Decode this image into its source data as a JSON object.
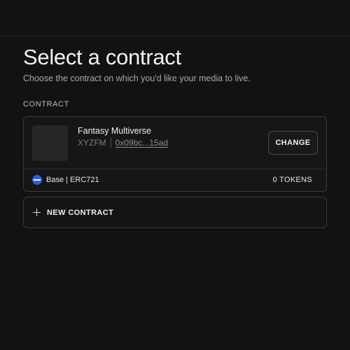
{
  "header": {
    "title": "Select a contract",
    "subtitle": "Choose the contract on which you'd like your media to live."
  },
  "section": {
    "label": "CONTRACT"
  },
  "contract": {
    "name": "Fantasy Multiverse",
    "symbol": "XYZFM",
    "address": "0x09bc...15ad",
    "change_label": "CHANGE",
    "network": "Base | ERC721",
    "tokens": "0 TOKENS",
    "network_color": "#2f5cf0"
  },
  "new_contract": {
    "label": "NEW CONTRACT",
    "icon": "plus-icon"
  }
}
